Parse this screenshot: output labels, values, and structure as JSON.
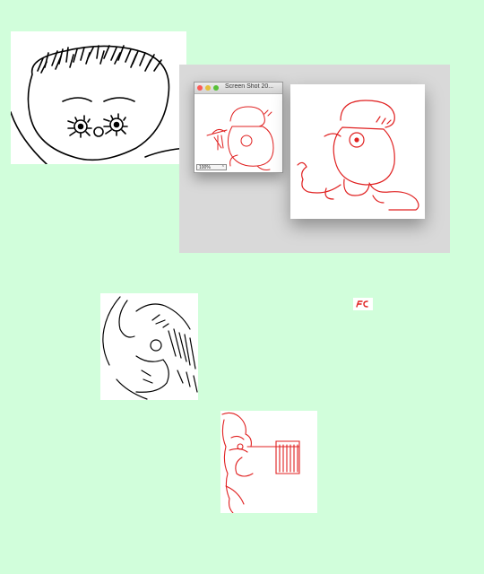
{
  "window": {
    "title": "Screen Shot 20...",
    "zoom_label": "100%",
    "zoom_caret": "⌃"
  },
  "icons": {
    "close": "traffic-close-icon",
    "minimize": "traffic-minimize-icon",
    "maximize": "traffic-maximize-icon"
  },
  "colors": {
    "background": "#d1fedb",
    "panel": "#d9d9d9",
    "sketch_black": "#000000",
    "sketch_red": "#e02020"
  }
}
